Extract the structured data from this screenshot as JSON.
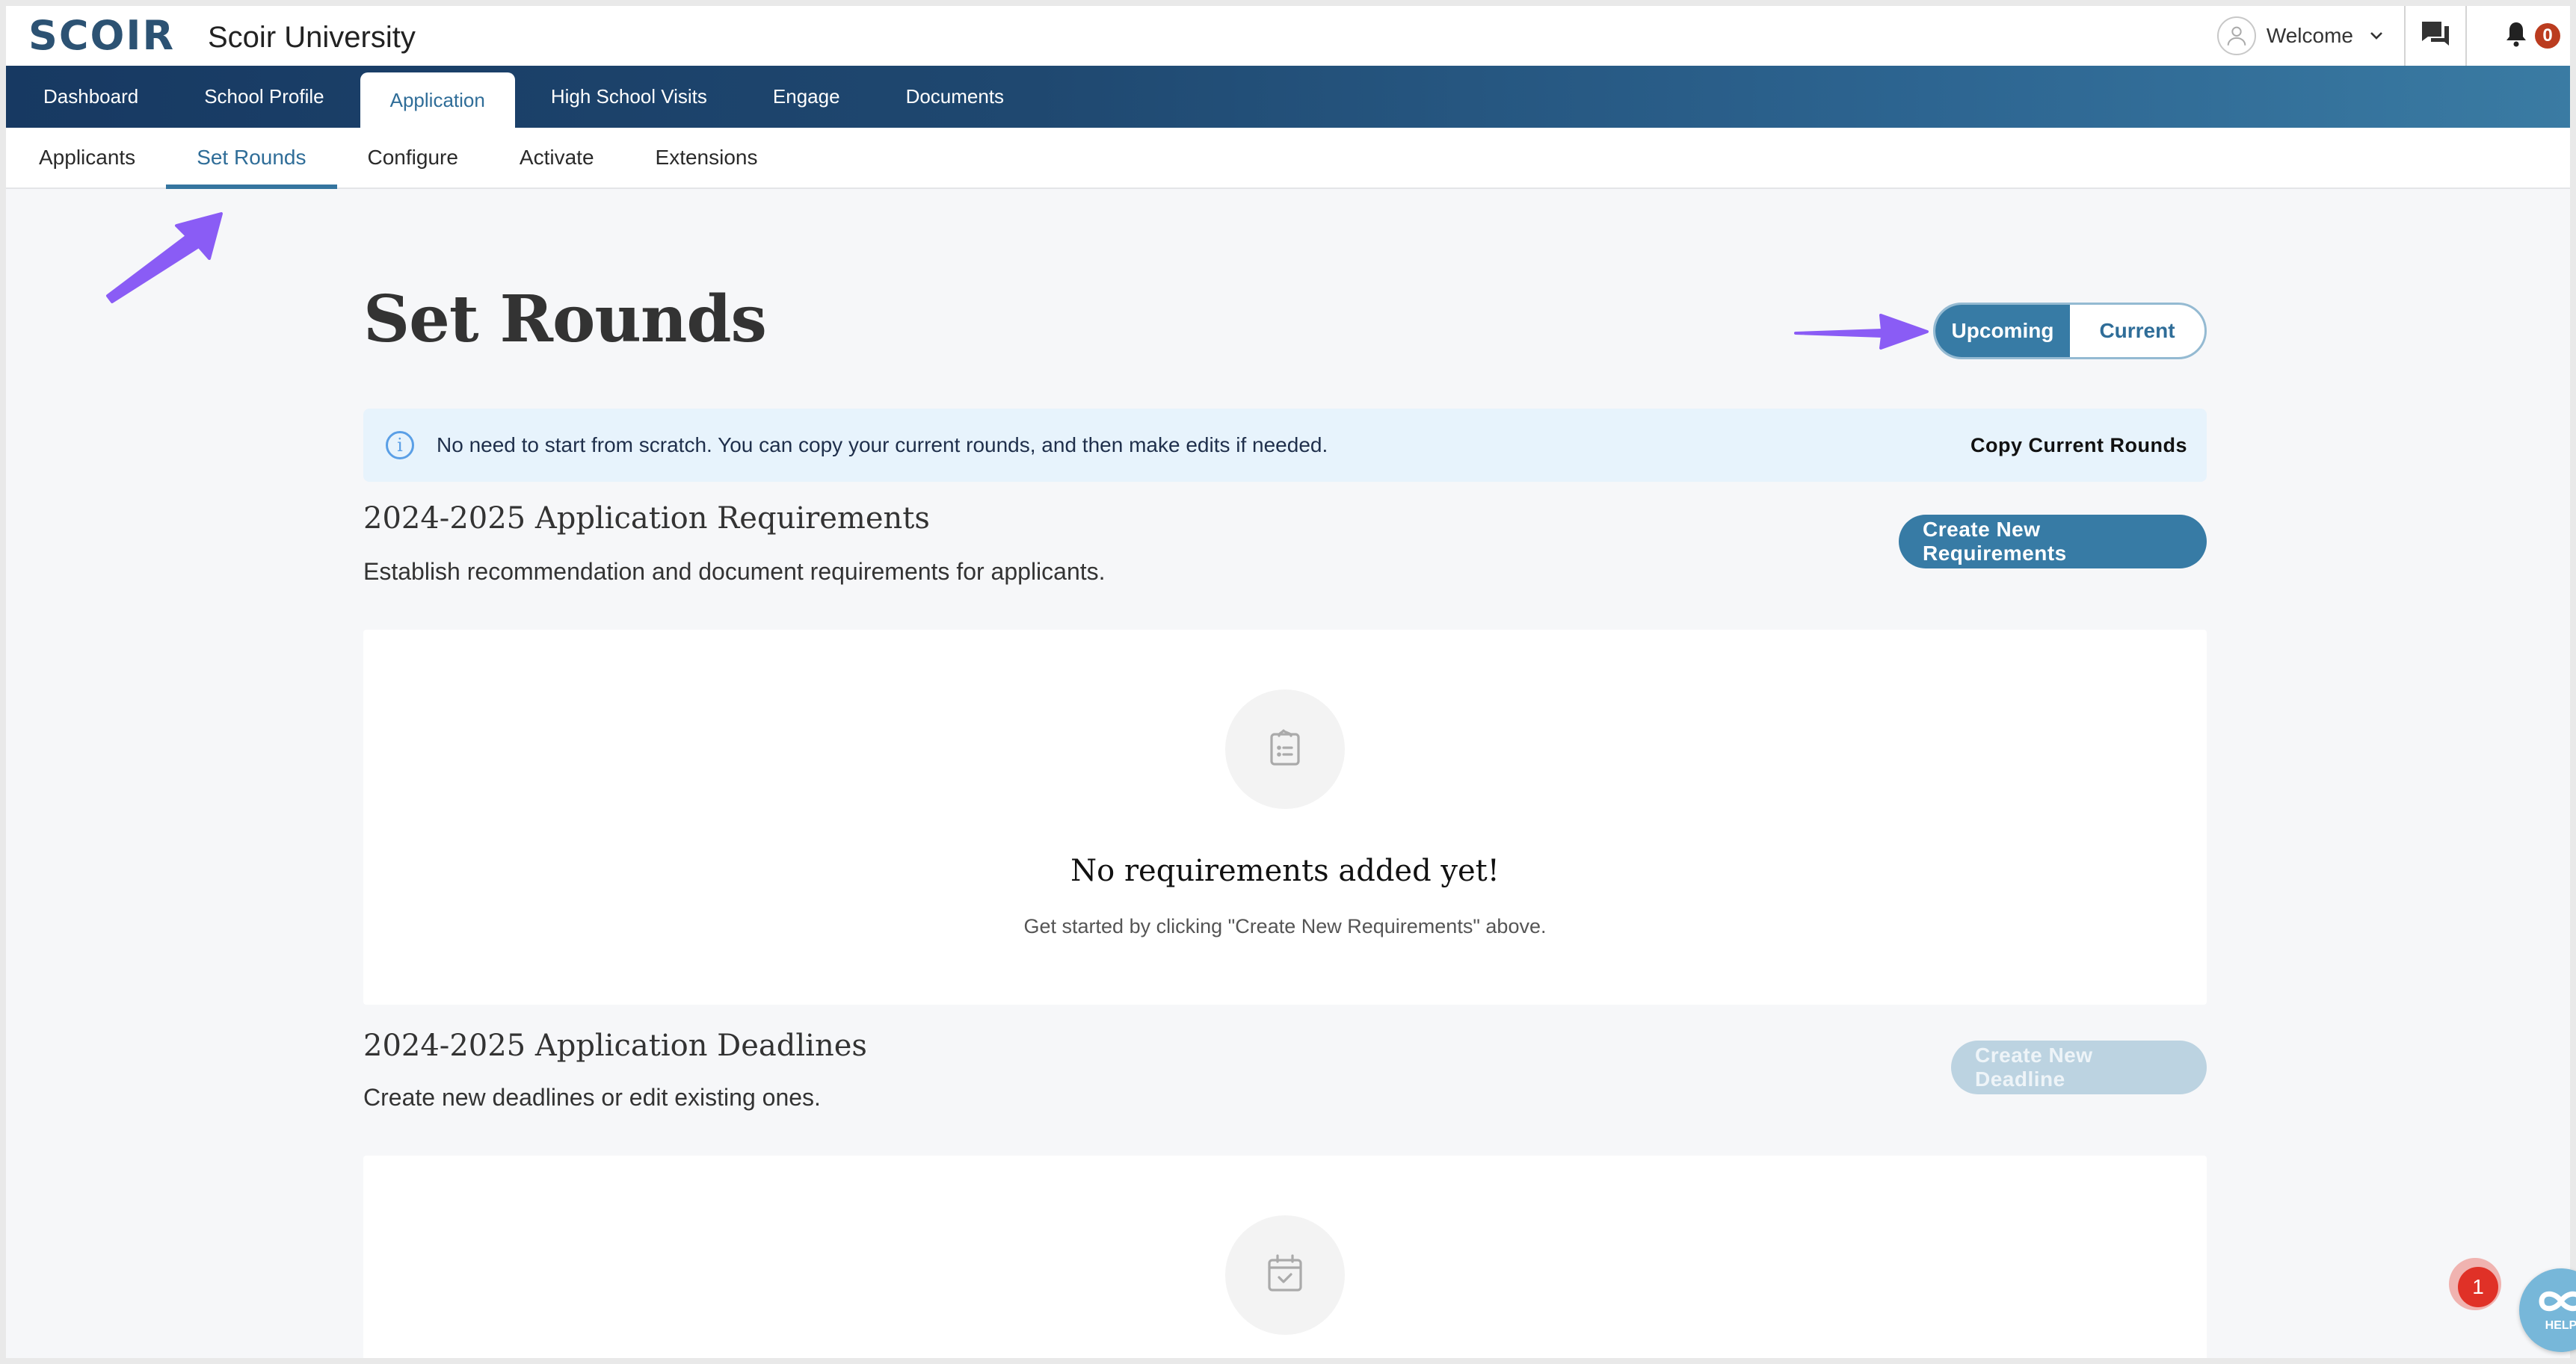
{
  "header": {
    "logo_text": "SCOIR",
    "school_name": "Scoir University",
    "welcome_label": "Welcome",
    "notification_count": "0",
    "icons": {
      "avatar": "user-avatar-icon",
      "dropdown": "chevron-down-icon",
      "messages": "chat-bubbles-icon",
      "notifications": "bell-icon"
    }
  },
  "main_nav": {
    "items": [
      {
        "label": "Dashboard",
        "active": false
      },
      {
        "label": "School Profile",
        "active": false
      },
      {
        "label": "Application",
        "active": true
      },
      {
        "label": "High School Visits",
        "active": false
      },
      {
        "label": "Engage",
        "active": false
      },
      {
        "label": "Documents",
        "active": false
      }
    ]
  },
  "sub_nav": {
    "items": [
      {
        "label": "Applicants",
        "active": false
      },
      {
        "label": "Set Rounds",
        "active": true
      },
      {
        "label": "Configure",
        "active": false
      },
      {
        "label": "Activate",
        "active": false
      },
      {
        "label": "Extensions",
        "active": false
      }
    ]
  },
  "page": {
    "title": "Set Rounds",
    "toggle": {
      "options": [
        {
          "label": "Upcoming",
          "active": true
        },
        {
          "label": "Current",
          "active": false
        }
      ]
    },
    "info_banner": {
      "icon": "info-icon",
      "text": "No need to start from scratch. You can copy your current rounds, and then make edits if needed.",
      "action_label": "Copy Current Rounds"
    },
    "requirements": {
      "title": "2024-2025 Application Requirements",
      "subtitle": "Establish recommendation and document requirements for applicants.",
      "button_label": "Create New Requirements",
      "empty_icon": "clipboard-list-icon",
      "empty_title": "No requirements added yet!",
      "empty_subtitle": "Get started by clicking \"Create New Requirements\" above."
    },
    "deadlines": {
      "title": "2024-2025 Application Deadlines",
      "subtitle": "Create new deadlines or edit existing ones.",
      "button_label": "Create New Deadline",
      "button_disabled": true,
      "empty_icon": "calendar-check-icon"
    }
  },
  "help_widget": {
    "label": "HELP",
    "badge_count": "1"
  },
  "colors": {
    "brand_dark": "#173962",
    "brand_primary": "#377ba5",
    "accent_active_text": "#2f6d98",
    "info_bg": "#e7f3fc",
    "notification_badge": "#bb3c1f",
    "annotation_arrow": "#8a5cf5",
    "help_widget": "#77b7d9",
    "help_badge": "#e03127"
  }
}
